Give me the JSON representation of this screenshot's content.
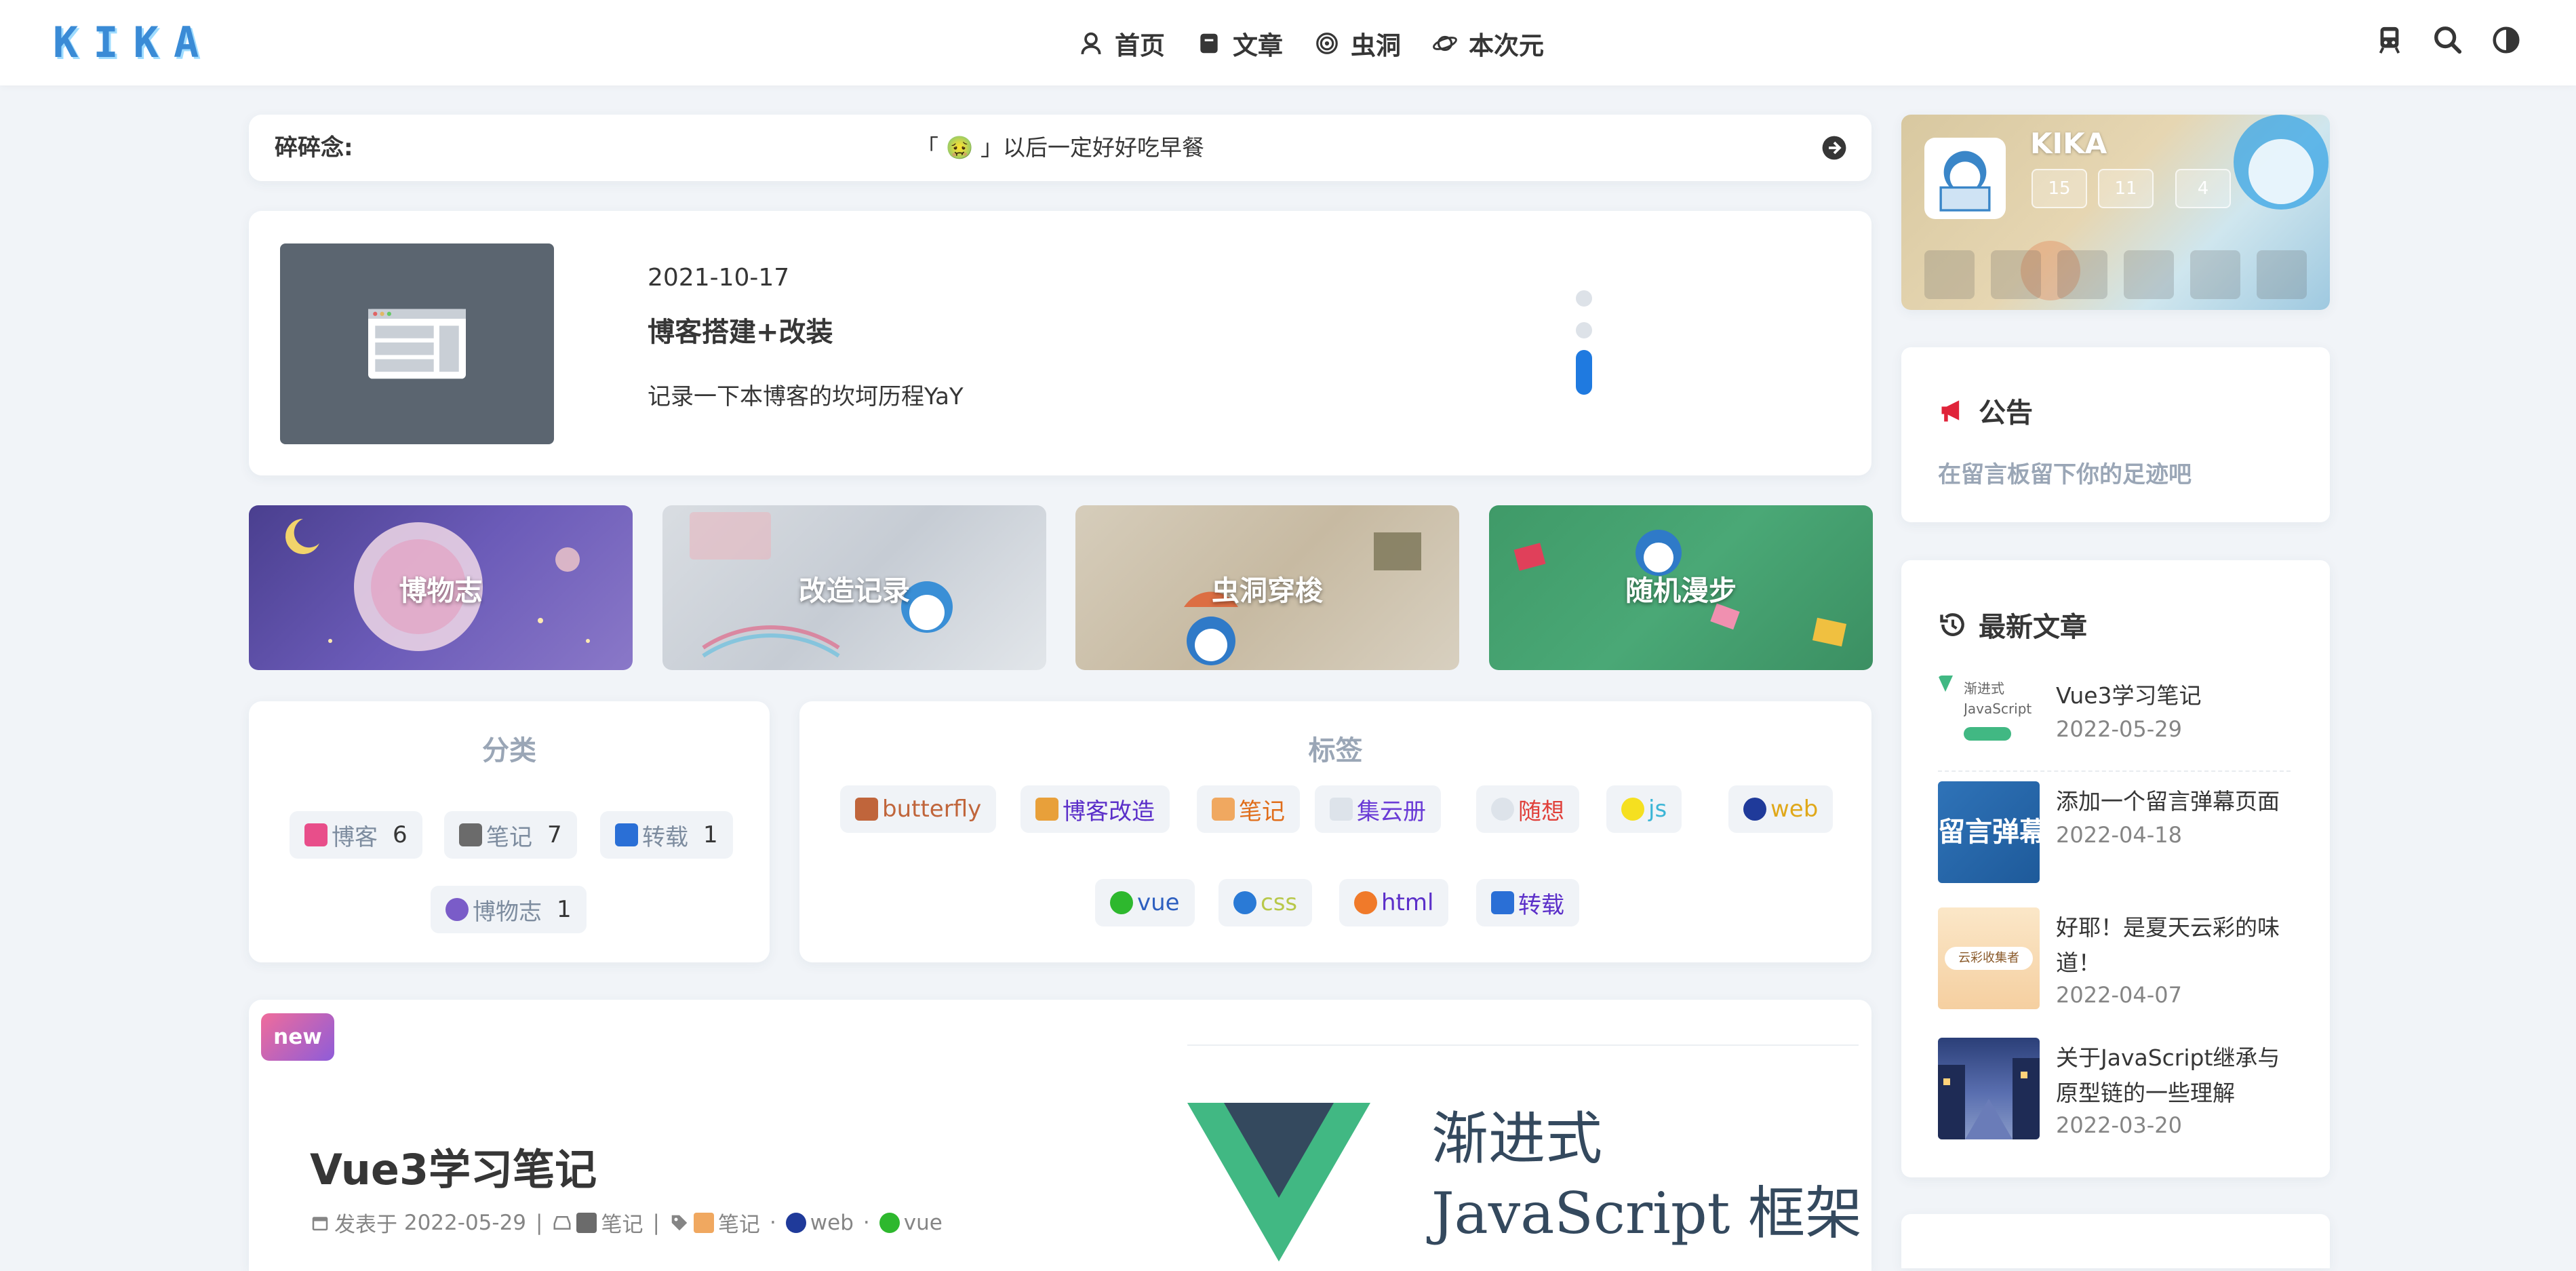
{
  "header": {
    "logo": "KIKA",
    "nav": [
      {
        "label": "首页",
        "icon": "user-badge-icon"
      },
      {
        "label": "文章",
        "icon": "book-icon"
      },
      {
        "label": "虫洞",
        "icon": "wormhole-icon"
      },
      {
        "label": "本次元",
        "icon": "planet-icon"
      }
    ],
    "actions": [
      "train-icon",
      "search-icon",
      "theme-toggle-icon"
    ]
  },
  "murmur": {
    "label": "碎碎念:",
    "text": "「 🤢 」以后一定好好吃早餐"
  },
  "slider": {
    "date": "2021-10-17",
    "title": "博客搭建+改装",
    "description": "记录一下本博客的坎坷历程YaY",
    "pages": 3,
    "active_page": 3
  },
  "banners": [
    {
      "label": "博物志",
      "color": "#5b4ea0"
    },
    {
      "label": "改造记录",
      "color": "#c9cfd6"
    },
    {
      "label": "虫洞穿梭",
      "color": "#c8bca8"
    },
    {
      "label": "随机漫步",
      "color": "#3f9a68"
    }
  ],
  "categories": {
    "title": "分类",
    "items": [
      {
        "label": "博客",
        "count": "6",
        "icon_color": "#e84e8a"
      },
      {
        "label": "笔记",
        "count": "7",
        "icon_color": "#6b6b6b"
      },
      {
        "label": "转载",
        "count": "1",
        "icon_color": "#2a6fd6"
      },
      {
        "label": "博物志",
        "count": "1",
        "icon_color": "#7a5cc8"
      }
    ]
  },
  "tags": {
    "title": "标签",
    "items": [
      {
        "label": "butterfly",
        "color": "#c0653b"
      },
      {
        "label": "博客改造",
        "color": "#5b2fc9"
      },
      {
        "label": "笔记",
        "color": "#e06d1a"
      },
      {
        "label": "集云册",
        "color": "#6a3bd6"
      },
      {
        "label": "随想",
        "color": "#e0403a"
      },
      {
        "label": "js",
        "color": "#3bb5d6"
      },
      {
        "label": "web",
        "color": "#e0a81a"
      },
      {
        "label": "vue",
        "color": "#2d5fc0"
      },
      {
        "label": "css",
        "color": "#b8c84a"
      },
      {
        "label": "html",
        "color": "#5b2fc9"
      },
      {
        "label": "转载",
        "color": "#5b2fc9"
      }
    ]
  },
  "post": {
    "badge": "new",
    "title": "Vue3学习笔记",
    "meta": {
      "published_label": "发表于",
      "date": "2022-05-29",
      "category": "笔记",
      "tags": [
        "笔记",
        "web",
        "vue"
      ]
    },
    "cover": {
      "line1": "渐进式",
      "line2": "JavaScript 框架"
    }
  },
  "sidebar": {
    "author": {
      "name": "KIKA",
      "stats": [
        "15",
        "11",
        "4"
      ],
      "socials": [
        "mail-icon",
        "netease-music-icon",
        "bilibili-icon",
        "github-icon",
        "csdn-icon",
        "juejin-icon"
      ]
    },
    "notice": {
      "title": "公告",
      "text": "在留言板留下你的足迹吧"
    },
    "recent": {
      "title": "最新文章",
      "posts": [
        {
          "title": "Vue3学习笔记",
          "date": "2022-05-29",
          "thumb_text": "渐进式 JavaScript 框架"
        },
        {
          "title": "添加一个留言弹幕页面",
          "date": "2022-04-18",
          "thumb_text": "留言弹幕"
        },
        {
          "title": "好耶！是夏天云彩的味道！",
          "date": "2022-04-07",
          "thumb_text": "云彩收集者"
        },
        {
          "title": "关于JavaScript继承与原型链的一些理解",
          "date": "2022-03-20",
          "thumb_text": ""
        }
      ]
    }
  },
  "colors": {
    "accent": "#49b1f5",
    "notice_icon": "#e0243a",
    "text": "#363636"
  }
}
